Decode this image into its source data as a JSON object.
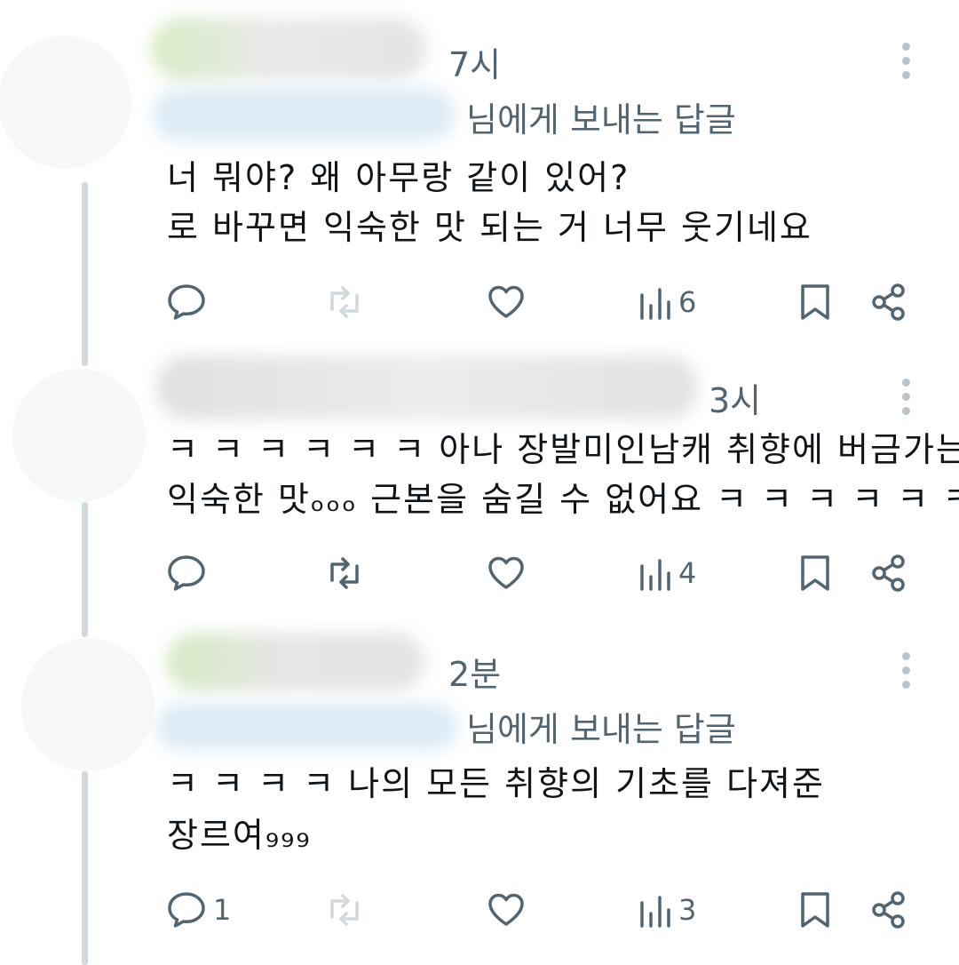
{
  "replies": [
    {
      "time": "7시",
      "reply_to_suffix": "님에게 보내는 답글",
      "lines": [
        "너 뭐야? 왜 아무랑 같이 있어?",
        "로 바꾸면 익숙한 맛 되는 거 너무 웃기네요"
      ],
      "reply_count": "",
      "views": "6"
    },
    {
      "time": "3시",
      "reply_to_suffix": "",
      "lines": [
        "ㅋ ㅋ ㅋ ㅋ ㅋ ㅋ 아나 장발미인남캐 취향에 버금가는",
        "익숙한 맛ₒₒₒ 근본을 숨길 수 없어요 ㅋ ㅋ ㅋ ㅋ ㅋ ㅋ"
      ],
      "reply_count": "",
      "views": "4"
    },
    {
      "time": "2분",
      "reply_to_suffix": "님에게 보내는 답글",
      "lines": [
        "ㅋ ㅋ ㅋ ㅋ 나의 모든 취향의 기초를 다져준",
        "장르여₉₉₉"
      ],
      "reply_count": "1",
      "views": "3"
    }
  ],
  "icons": {
    "reply": "reply-icon",
    "retweet": "retweet-icon",
    "like": "heart-icon",
    "views": "views-chart-icon",
    "bookmark": "bookmark-icon",
    "share": "share-icon",
    "more": "more-vertical-icon"
  },
  "colors": {
    "text": "#0f1419",
    "secondary": "#536471",
    "muted_icon": "#cfd9de",
    "thread_line": "#cfd9de"
  }
}
